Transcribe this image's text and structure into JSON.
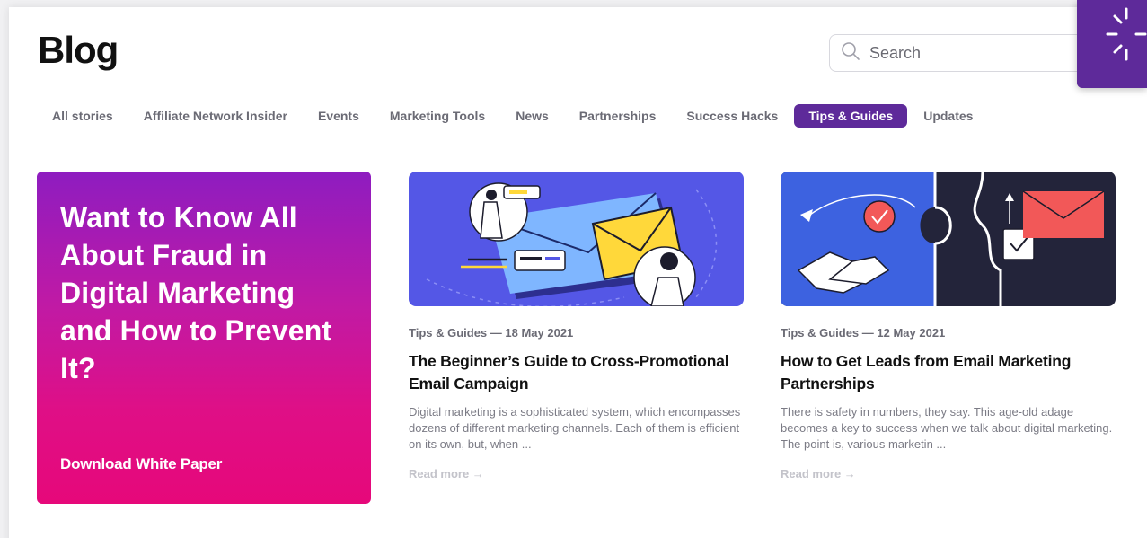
{
  "header": {
    "title": "Blog",
    "search": {
      "placeholder": "Search",
      "value": ""
    }
  },
  "tabs": [
    {
      "label": "All stories",
      "active": false
    },
    {
      "label": "Affiliate Network Insider",
      "active": false
    },
    {
      "label": "Events",
      "active": false
    },
    {
      "label": "Marketing Tools",
      "active": false
    },
    {
      "label": "News",
      "active": false
    },
    {
      "label": "Partnerships",
      "active": false
    },
    {
      "label": "Success Hacks",
      "active": false
    },
    {
      "label": "Tips & Guides",
      "active": true
    },
    {
      "label": "Updates",
      "active": false
    }
  ],
  "promo": {
    "headline": "Want to Know All About Fraud in Digital Marketing and How to Prevent It?",
    "cta": "Download White Paper"
  },
  "articles": [
    {
      "meta": "Tips & Guides — 18 May 2021",
      "title": "The Beginner’s Guide to Cross-Promotional Email Campaign",
      "excerpt": "Digital marketing is a sophisticated system, which encompasses dozens of different marketing channels. Each of them is efficient on its own, but, when ...",
      "read_more": "Read more →",
      "image_icon": "email-campaign-illustration"
    },
    {
      "meta": "Tips & Guides — 12 May 2021",
      "title": "How to Get Leads from Email Marketing Partnerships",
      "excerpt": "There is safety in numbers, they say. This age-old adage becomes a key to success when we talk about digital marketing. The point is, various marketin ...",
      "read_more": "Read more →",
      "image_icon": "handshake-puzzle-illustration"
    }
  ],
  "colors": {
    "accent": "#5e2a9a",
    "promo_top": "#8e1cc0",
    "promo_bottom": "#e6087a",
    "card1_bg": "#5457e6",
    "card2_left": "#3d62e0",
    "card2_right": "#23243a",
    "envelope_red": "#f25858"
  }
}
